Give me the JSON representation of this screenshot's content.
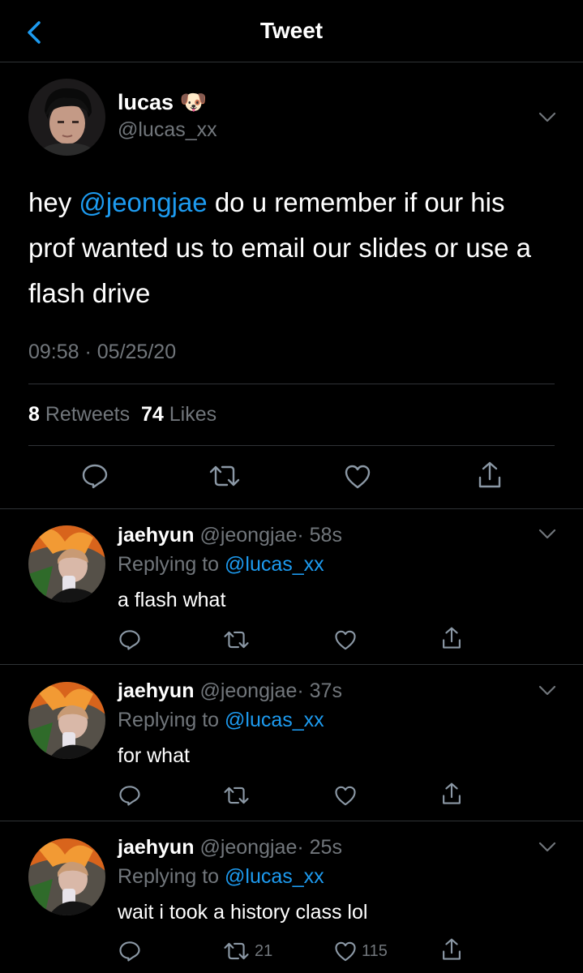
{
  "header": {
    "title": "Tweet"
  },
  "tweet": {
    "author_name": "lucas",
    "author_emoji": "🐶",
    "author_handle": "@lucas_xx",
    "text_part1": "hey ",
    "mention": "@jeongjae",
    "text_part2": " do u remember if our his prof wanted us to email our slides or use a flash drive",
    "timestamp": "09:58 · 05/25/20",
    "retweet_count": "8",
    "retweet_label": "Retweets",
    "like_count": "74",
    "like_label": "Likes"
  },
  "replies": [
    {
      "name": "jaehyun",
      "handle": "@jeongjae",
      "time": "· 58s",
      "replying_prefix": "Replying to",
      "replying_to": "@lucas_xx",
      "text": "a flash what",
      "retweets": "",
      "likes": ""
    },
    {
      "name": "jaehyun",
      "handle": "@jeongjae",
      "time": "· 37s",
      "replying_prefix": "Replying to",
      "replying_to": "@lucas_xx",
      "text": "for what",
      "retweets": "",
      "likes": ""
    },
    {
      "name": "jaehyun",
      "handle": "@jeongjae",
      "time": "· 25s",
      "replying_prefix": "Replying to",
      "replying_to": "@lucas_xx",
      "text": "wait i took a history class lol",
      "retweets": "21",
      "likes": "115"
    }
  ],
  "colors": {
    "background": "#000000",
    "accent": "#1d9bf0",
    "secondary_text": "#71767b",
    "divider": "#2f3336"
  },
  "icons": [
    "back-arrow-icon",
    "chevron-down-icon",
    "reply-icon",
    "retweet-icon",
    "like-icon",
    "share-icon"
  ]
}
